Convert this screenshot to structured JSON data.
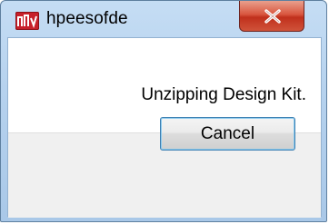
{
  "window": {
    "title": "hpeesofde",
    "close_label": "X"
  },
  "message": {
    "text": "Unzipping Design Kit."
  },
  "buttons": {
    "cancel_label": "Cancel"
  },
  "icons": {
    "app": "hpeesofde-app-icon",
    "close": "close-icon"
  },
  "colors": {
    "titlebar": "#b6d2ee",
    "close_button": "#c8402a",
    "app_icon": "#c7202a",
    "footer": "#f0f0f0"
  }
}
